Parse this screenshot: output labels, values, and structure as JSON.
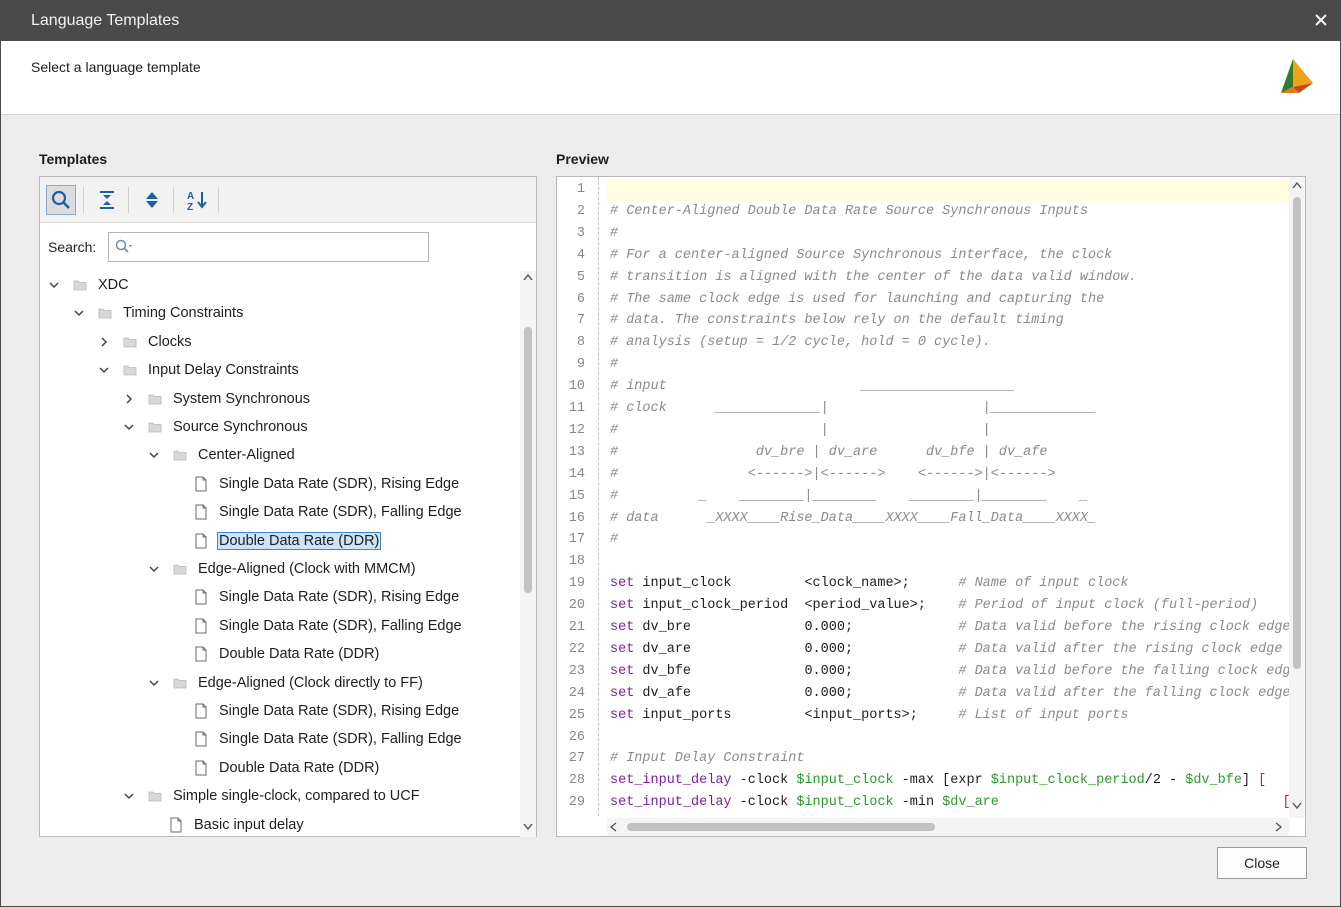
{
  "window": {
    "title": "Language Templates",
    "subtitle": "Select a language template"
  },
  "templates": {
    "label": "Templates",
    "search_label": "Search:",
    "search_placeholder": "",
    "toolbar": [
      "search-icon",
      "collapse-all-icon",
      "expand-all-icon",
      "sort-az-icon"
    ],
    "tree": [
      {
        "text": "XDC",
        "level": 0,
        "type": "folder",
        "expanded": true
      },
      {
        "text": "Timing Constraints",
        "level": 1,
        "type": "folder",
        "expanded": true
      },
      {
        "text": "Clocks",
        "level": 2,
        "type": "folder",
        "expanded": false
      },
      {
        "text": "Input Delay Constraints",
        "level": 2,
        "type": "folder",
        "expanded": true
      },
      {
        "text": "System Synchronous",
        "level": 3,
        "type": "folder",
        "expanded": false
      },
      {
        "text": "Source Synchronous",
        "level": 3,
        "type": "folder",
        "expanded": true
      },
      {
        "text": "Center-Aligned",
        "level": 4,
        "type": "folder",
        "expanded": true
      },
      {
        "text": "Single Data Rate (SDR), Rising Edge",
        "level": 5,
        "type": "file"
      },
      {
        "text": "Single Data Rate (SDR), Falling Edge",
        "level": 5,
        "type": "file"
      },
      {
        "text": "Double Data Rate (DDR)",
        "level": 5,
        "type": "file",
        "selected": true
      },
      {
        "text": "Edge-Aligned (Clock with MMCM)",
        "level": 4,
        "type": "folder",
        "expanded": true
      },
      {
        "text": "Single Data Rate (SDR), Rising Edge",
        "level": 5,
        "type": "file"
      },
      {
        "text": "Single Data Rate (SDR), Falling Edge",
        "level": 5,
        "type": "file"
      },
      {
        "text": "Double Data Rate (DDR)",
        "level": 5,
        "type": "file"
      },
      {
        "text": "Edge-Aligned (Clock directly to FF)",
        "level": 4,
        "type": "folder",
        "expanded": true
      },
      {
        "text": "Single Data Rate (SDR), Rising Edge",
        "level": 5,
        "type": "file"
      },
      {
        "text": "Single Data Rate (SDR), Falling Edge",
        "level": 5,
        "type": "file"
      },
      {
        "text": "Double Data Rate (DDR)",
        "level": 5,
        "type": "file"
      },
      {
        "text": "Simple single-clock, compared to UCF",
        "level": 3,
        "type": "folder",
        "expanded": true
      },
      {
        "text": "Basic input delay",
        "level": 4,
        "type": "file"
      }
    ]
  },
  "preview": {
    "label": "Preview",
    "lines": [
      {
        "n": "1",
        "segs": []
      },
      {
        "n": "2",
        "segs": [
          {
            "t": "# Center-Aligned Double Data Rate Source Synchronous Inputs",
            "c": "cmt"
          }
        ]
      },
      {
        "n": "3",
        "segs": [
          {
            "t": "#",
            "c": "cmt"
          }
        ]
      },
      {
        "n": "4",
        "segs": [
          {
            "t": "# For a center-aligned Source Synchronous interface, the clock",
            "c": "cmt"
          }
        ]
      },
      {
        "n": "5",
        "segs": [
          {
            "t": "# transition is aligned with the center of the data valid window.",
            "c": "cmt"
          }
        ]
      },
      {
        "n": "6",
        "segs": [
          {
            "t": "# The same clock edge is used for launching and capturing the",
            "c": "cmt"
          }
        ]
      },
      {
        "n": "7",
        "segs": [
          {
            "t": "# data. The constraints below rely on the default timing",
            "c": "cmt"
          }
        ]
      },
      {
        "n": "8",
        "segs": [
          {
            "t": "# analysis (setup = 1/2 cycle, hold = 0 cycle).",
            "c": "cmt"
          }
        ]
      },
      {
        "n": "9",
        "segs": [
          {
            "t": "#",
            "c": "cmt"
          }
        ]
      },
      {
        "n": "10",
        "segs": [
          {
            "t": "# input                        ___________________",
            "c": "cmt"
          }
        ]
      },
      {
        "n": "11",
        "segs": [
          {
            "t": "# clock      _____________|                   |_____________",
            "c": "cmt"
          }
        ]
      },
      {
        "n": "12",
        "segs": [
          {
            "t": "#                         |                   |",
            "c": "cmt"
          }
        ]
      },
      {
        "n": "13",
        "segs": [
          {
            "t": "#                 dv_bre | dv_are      dv_bfe | dv_afe",
            "c": "cmt"
          }
        ]
      },
      {
        "n": "14",
        "segs": [
          {
            "t": "#                <------>|<------>    <------>|<------>",
            "c": "cmt"
          }
        ]
      },
      {
        "n": "15",
        "segs": [
          {
            "t": "#          _    ________|________    ________|________    _",
            "c": "cmt"
          }
        ]
      },
      {
        "n": "16",
        "segs": [
          {
            "t": "# data      _XXXX____Rise_Data____XXXX____Fall_Data____XXXX_",
            "c": "cmt"
          }
        ]
      },
      {
        "n": "17",
        "segs": [
          {
            "t": "#",
            "c": "cmt"
          }
        ]
      },
      {
        "n": "18",
        "segs": []
      },
      {
        "n": "19",
        "segs": [
          {
            "t": "set",
            "c": "kw"
          },
          {
            "t": " input_clock         <clock_name>;      ",
            "c": "txt"
          },
          {
            "t": "# Name of input clock",
            "c": "cmt"
          }
        ]
      },
      {
        "n": "20",
        "segs": [
          {
            "t": "set",
            "c": "kw"
          },
          {
            "t": " input_clock_period  <period_value>;    ",
            "c": "txt"
          },
          {
            "t": "# Period of input clock (full-period)",
            "c": "cmt"
          }
        ]
      },
      {
        "n": "21",
        "segs": [
          {
            "t": "set",
            "c": "kw"
          },
          {
            "t": " dv_bre              0.000;             ",
            "c": "txt"
          },
          {
            "t": "# Data valid before the rising clock edge",
            "c": "cmt"
          }
        ]
      },
      {
        "n": "22",
        "segs": [
          {
            "t": "set",
            "c": "kw"
          },
          {
            "t": " dv_are              0.000;             ",
            "c": "txt"
          },
          {
            "t": "# Data valid after the rising clock edge",
            "c": "cmt"
          }
        ]
      },
      {
        "n": "23",
        "segs": [
          {
            "t": "set",
            "c": "kw"
          },
          {
            "t": " dv_bfe              0.000;             ",
            "c": "txt"
          },
          {
            "t": "# Data valid before the falling clock edge",
            "c": "cmt"
          }
        ]
      },
      {
        "n": "24",
        "segs": [
          {
            "t": "set",
            "c": "kw"
          },
          {
            "t": " dv_afe              0.000;             ",
            "c": "txt"
          },
          {
            "t": "# Data valid after the falling clock edge",
            "c": "cmt"
          }
        ]
      },
      {
        "n": "25",
        "segs": [
          {
            "t": "set",
            "c": "kw"
          },
          {
            "t": " input_ports         <input_ports>;     ",
            "c": "txt"
          },
          {
            "t": "# List of input ports",
            "c": "cmt"
          }
        ]
      },
      {
        "n": "26",
        "segs": []
      },
      {
        "n": "27",
        "segs": [
          {
            "t": "# Input Delay Constraint",
            "c": "cmt"
          }
        ]
      },
      {
        "n": "28",
        "segs": [
          {
            "t": "set_input_delay",
            "c": "kw"
          },
          {
            "t": " -clock ",
            "c": "txt"
          },
          {
            "t": "$input_clock",
            "c": "var"
          },
          {
            "t": " -max [expr ",
            "c": "txt"
          },
          {
            "t": "$input_clock_period",
            "c": "var"
          },
          {
            "t": "/2 - ",
            "c": "txt"
          },
          {
            "t": "$dv_bfe",
            "c": "var"
          },
          {
            "t": "] ",
            "c": "txt"
          },
          {
            "t": "[",
            "c": "red"
          }
        ]
      },
      {
        "n": "29",
        "segs": [
          {
            "t": "set_input_delay",
            "c": "kw"
          },
          {
            "t": " -clock ",
            "c": "txt"
          },
          {
            "t": "$input_clock",
            "c": "var"
          },
          {
            "t": " -min ",
            "c": "txt"
          },
          {
            "t": "$dv_are",
            "c": "var"
          },
          {
            "t": "                                   ",
            "c": "txt"
          },
          {
            "t": "[",
            "c": "red"
          }
        ]
      }
    ]
  },
  "buttons": {
    "close": "Close"
  }
}
